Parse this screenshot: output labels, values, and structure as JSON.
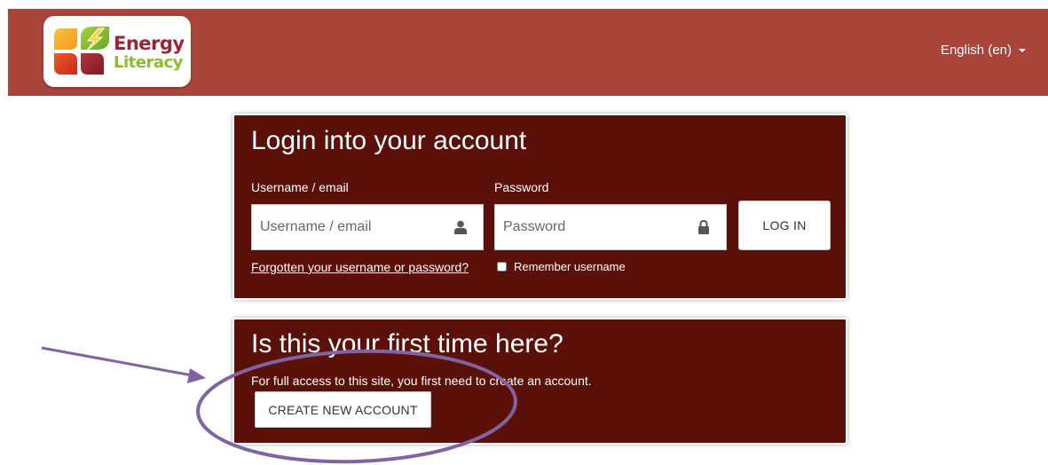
{
  "header": {
    "logo": {
      "line1": "Energy",
      "line2": "Literacy",
      "colors": [
        "#f5b323",
        "#e8402b",
        "#9b2335",
        "#8bbd2a"
      ]
    },
    "language_label": "English (en)",
    "background": "#a9443a"
  },
  "login": {
    "title": "Login into your account",
    "username_label": "Username / email",
    "username_placeholder": "Username / email",
    "username_value": "",
    "username_icon": "user-icon",
    "password_label": "Password",
    "password_placeholder": "Password",
    "password_value": "",
    "password_icon": "lock-icon",
    "login_button": "LOG IN",
    "forgot_link": "Forgotten your username or password?",
    "remember_label": "Remember username",
    "remember_checked": false,
    "card_color": "#5a1109"
  },
  "signup": {
    "title": "Is this your first time here?",
    "text": "For full access to this site, you first need to create an account.",
    "create_button": "CREATE NEW ACCOUNT"
  },
  "annotation": {
    "type": "arrow-and-ellipse",
    "color": "#8064a2"
  }
}
